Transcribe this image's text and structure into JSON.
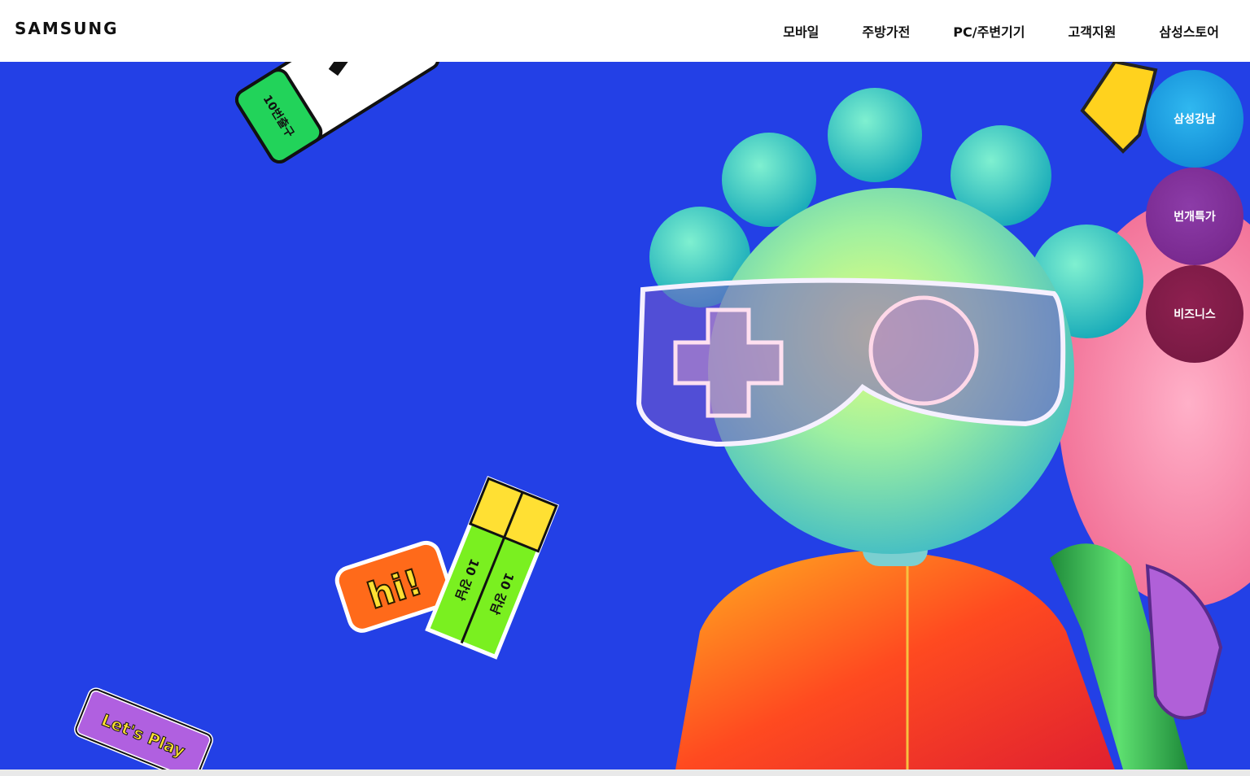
{
  "header": {
    "logo": "SAMSUNG",
    "nav": [
      "모바일",
      "주방가전",
      "PC/주변기기",
      "고객지원",
      "삼성스토어"
    ]
  },
  "side_nav": [
    "삼성강남",
    "번개특가",
    "비즈니스"
  ],
  "hero": {
    "stickers": {
      "exit_sign": "10번출구",
      "hi": "hi!",
      "bar_left": "10 강남",
      "bar_right": "10 강남",
      "lets_play": "Let's Play"
    }
  },
  "colors": {
    "hero_bg": "#2340e6",
    "header_bg": "#ffffff"
  }
}
